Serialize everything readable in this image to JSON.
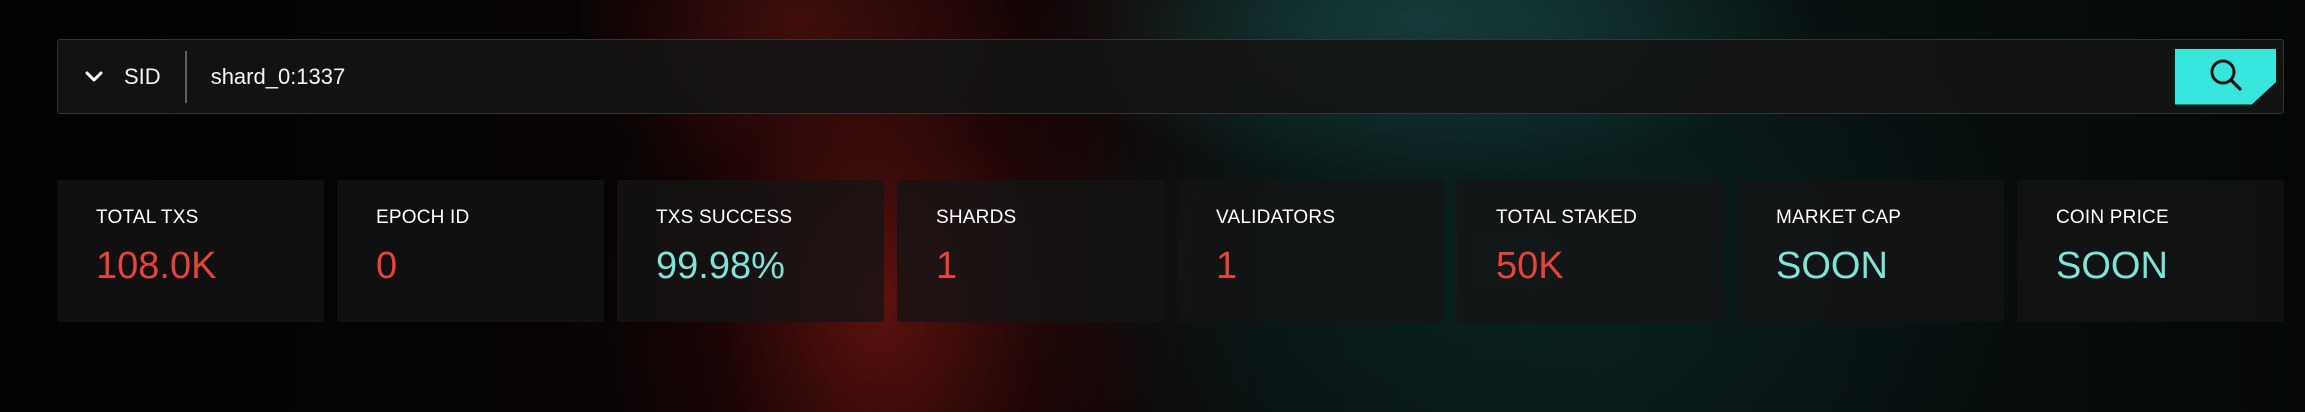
{
  "search": {
    "selector_label": "SID",
    "value": "shard_0:1337",
    "placeholder": "",
    "button_color": "#36e6dc"
  },
  "stats": [
    {
      "label": "TOTAL TXS",
      "value": "108.0K",
      "color": "#e8433a"
    },
    {
      "label": "EPOCH ID",
      "value": "0",
      "color": "#e8433a"
    },
    {
      "label": "TXS SUCCESS",
      "value": "99.98%",
      "color": "#7fe3d8"
    },
    {
      "label": "SHARDS",
      "value": "1",
      "color": "#e8433a"
    },
    {
      "label": "VALIDATORS",
      "value": "1",
      "color": "#e8433a"
    },
    {
      "label": "TOTAL STAKED",
      "value": "50K",
      "color": "#e8433a"
    },
    {
      "label": "MARKET CAP",
      "value": "SOON",
      "color": "#7fe3d8"
    },
    {
      "label": "COIN PRICE",
      "value": "SOON",
      "color": "#7fe3d8"
    }
  ],
  "icons": {
    "selector": "chevron-down-icon",
    "search_button": "search-icon"
  }
}
